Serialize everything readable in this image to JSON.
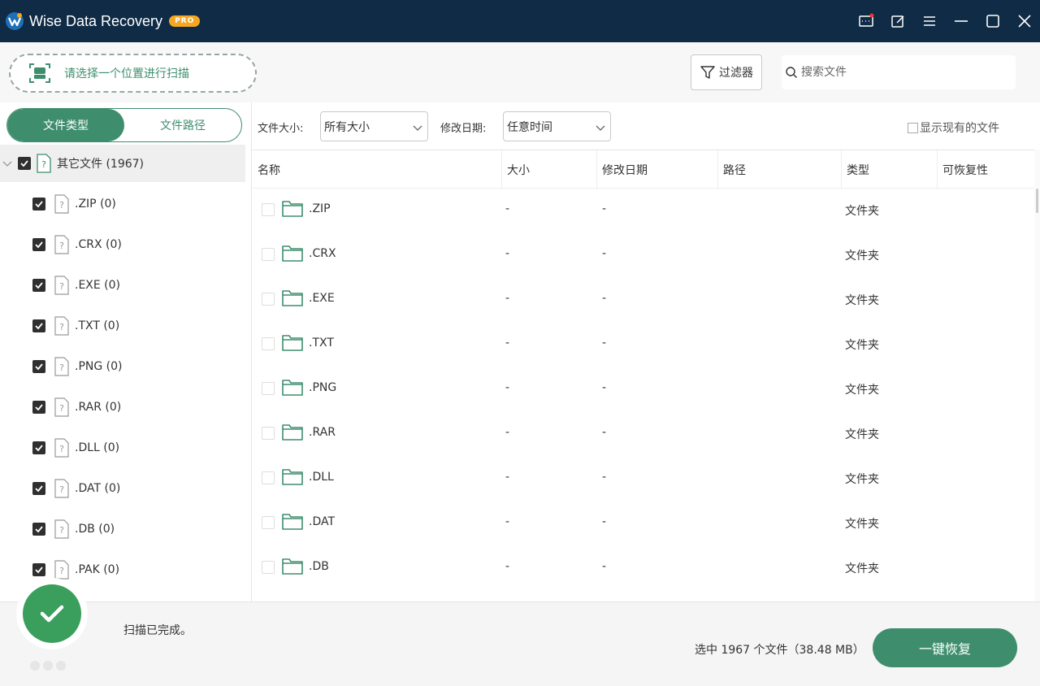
{
  "titlebar": {
    "title": "Wise Data Recovery",
    "badge": "PRO",
    "icons": [
      "feedback-icon",
      "edit-icon",
      "menu-icon",
      "minimize-icon",
      "maximize-icon",
      "close-icon"
    ]
  },
  "toolbar": {
    "scan_location_label": "请选择一个位置进行扫描",
    "filter_label": "过滤器",
    "search_placeholder": "搜索文件"
  },
  "sidebar": {
    "tabs": [
      {
        "label": "文件类型",
        "active": true
      },
      {
        "label": "文件路径",
        "active": false
      }
    ],
    "root": {
      "label": "其它文件 (1967)",
      "checked": true
    },
    "items": [
      {
        "label": ".ZIP (0)",
        "checked": true
      },
      {
        "label": ".CRX (0)",
        "checked": true
      },
      {
        "label": ".EXE (0)",
        "checked": true
      },
      {
        "label": ".TXT (0)",
        "checked": true
      },
      {
        "label": ".PNG (0)",
        "checked": true
      },
      {
        "label": ".RAR (0)",
        "checked": true
      },
      {
        "label": ".DLL (0)",
        "checked": true
      },
      {
        "label": ".DAT (0)",
        "checked": true
      },
      {
        "label": ".DB (0)",
        "checked": true
      },
      {
        "label": ".PAK (0)",
        "checked": true
      }
    ]
  },
  "filters": {
    "size_label": "文件大小:",
    "size_value": "所有大小",
    "date_label": "修改日期:",
    "date_value": "任意时间",
    "show_existing_label": "显示现有的文件",
    "show_existing_checked": false
  },
  "table": {
    "columns": [
      "名称",
      "大小",
      "修改日期",
      "路径",
      "类型",
      "可恢复性"
    ],
    "rows": [
      {
        "name": ".ZIP",
        "size": "-",
        "date": "-",
        "path": "",
        "type": "文件夹",
        "recoverability": ""
      },
      {
        "name": ".CRX",
        "size": "-",
        "date": "-",
        "path": "",
        "type": "文件夹",
        "recoverability": ""
      },
      {
        "name": ".EXE",
        "size": "-",
        "date": "-",
        "path": "",
        "type": "文件夹",
        "recoverability": ""
      },
      {
        "name": ".TXT",
        "size": "-",
        "date": "-",
        "path": "",
        "type": "文件夹",
        "recoverability": ""
      },
      {
        "name": ".PNG",
        "size": "-",
        "date": "-",
        "path": "",
        "type": "文件夹",
        "recoverability": ""
      },
      {
        "name": ".RAR",
        "size": "-",
        "date": "-",
        "path": "",
        "type": "文件夹",
        "recoverability": ""
      },
      {
        "name": ".DLL",
        "size": "-",
        "date": "-",
        "path": "",
        "type": "文件夹",
        "recoverability": ""
      },
      {
        "name": ".DAT",
        "size": "-",
        "date": "-",
        "path": "",
        "type": "文件夹",
        "recoverability": ""
      },
      {
        "name": ".DB",
        "size": "-",
        "date": "-",
        "path": "",
        "type": "文件夹",
        "recoverability": ""
      }
    ]
  },
  "status": {
    "message": "扫描已完成。",
    "selection_info": "选中 1967 个文件（38.48 MB）",
    "recover_button": "一键恢复"
  },
  "colors": {
    "titlebar_bg": "#0f2b45",
    "accent_green": "#3e8e6e",
    "badge_orange": "#f5a623",
    "success_green": "#3a9e5c"
  }
}
